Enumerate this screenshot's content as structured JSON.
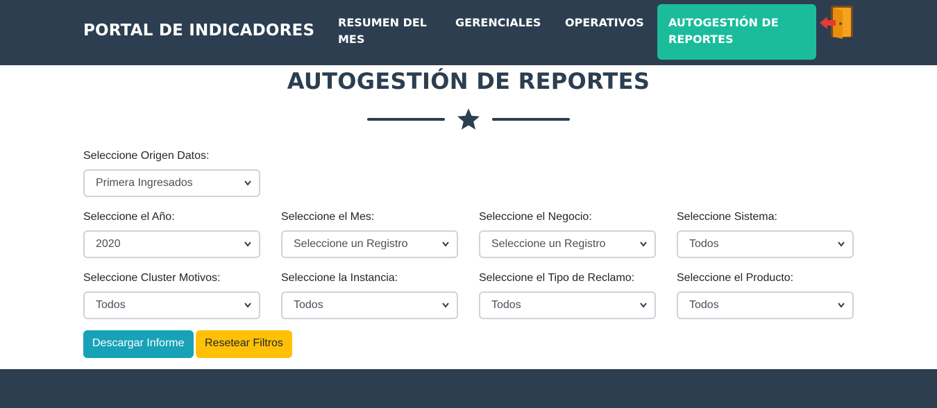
{
  "navbar": {
    "brand": "PORTAL DE INDICADORES",
    "items": [
      {
        "label": "RESUMEN DEL MES",
        "line1": "RESUMEN DEL",
        "line2": "MES",
        "active": false
      },
      {
        "label": "GERENCIALES",
        "active": false
      },
      {
        "label": "OPERATIVOS",
        "active": false
      },
      {
        "label": "AUTOGESTIÓN DE REPORTES",
        "line1": "AUTOGESTIÓN DE",
        "line2": "REPORTES",
        "active": true
      }
    ],
    "logout_icon": "exit-door-icon",
    "active_color": "#1abc9c",
    "bg_color": "#2c3e50"
  },
  "page": {
    "title": "AUTOGESTIÓN DE REPORTES",
    "divider_icon": "star-icon"
  },
  "filters": {
    "origen": {
      "label": "Seleccione Origen Datos:",
      "value": "Primera Ingresados"
    },
    "anio": {
      "label": "Seleccione el Año:",
      "value": "2020"
    },
    "mes": {
      "label": "Seleccione el Mes:",
      "value": "Seleccione un Registro"
    },
    "negocio": {
      "label": "Seleccione el Negocio:",
      "value": "Seleccione un Registro"
    },
    "sistema": {
      "label": "Seleccione Sistema:",
      "value": "Todos"
    },
    "cluster": {
      "label": "Seleccione Cluster Motivos:",
      "value": "Todos"
    },
    "instancia": {
      "label": "Seleccione la Instancia:",
      "value": "Todos"
    },
    "tipo_reclamo": {
      "label": "Seleccione el Tipo de Reclamo:",
      "value": "Todos"
    },
    "producto": {
      "label": "Seleccione el Producto:",
      "value": "Todos"
    }
  },
  "actions": {
    "download": "Descargar Informe",
    "reset": "Resetear Filtros",
    "download_color": "#17a2b8",
    "reset_color": "#ffc107"
  }
}
